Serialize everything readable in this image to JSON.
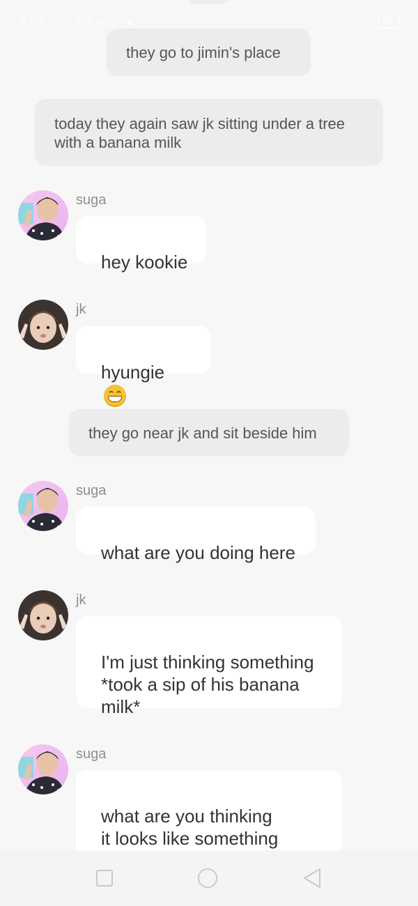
{
  "status_bar": {
    "time": "3:24",
    "signal_text": "4G",
    "data_speed": "3.16 KB/S",
    "battery_level": "56"
  },
  "messages": [
    {
      "kind": "narration",
      "text": "they go to jimin's place"
    },
    {
      "kind": "narration",
      "text": "today they again saw jk sitting under a tree with a banana milk"
    },
    {
      "kind": "chat",
      "name": "suga",
      "text": "hey kookie"
    },
    {
      "kind": "chat",
      "name": "jk",
      "text": "hyungie",
      "emoji": "grinning-face-emoji"
    },
    {
      "kind": "narration",
      "text": "they go near jk and sit beside him"
    },
    {
      "kind": "chat",
      "name": "suga",
      "text": "what are you doing here"
    },
    {
      "kind": "chat",
      "name": "jk",
      "text": "I'm just thinking something\n*took a sip of his banana\nmilk*"
    },
    {
      "kind": "chat",
      "name": "suga",
      "text": "what are you thinking\nit looks like something\nimportant"
    }
  ],
  "nav_bar": {
    "icons": [
      "recent-apps-icon",
      "home-icon",
      "back-icon"
    ]
  },
  "colors": {
    "background": "#f7f7f7",
    "narration_bg": "#ececec",
    "chat_bubble_bg": "#ffffff",
    "name_text": "#8e8e8e"
  }
}
